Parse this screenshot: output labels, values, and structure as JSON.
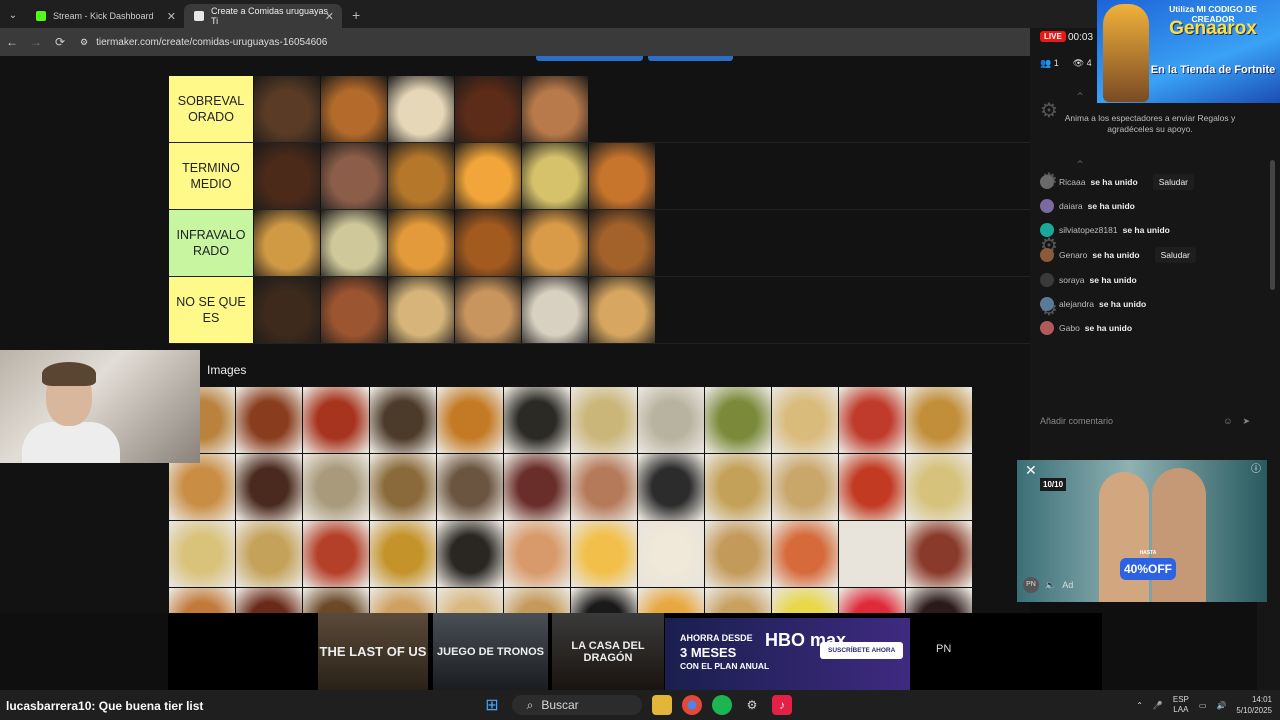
{
  "browser": {
    "tabs": [
      {
        "label": "Stream - Kick Dashboard",
        "favicon_color": "#53fc18"
      },
      {
        "label": "Create a Comidas uruguayas Ti",
        "favicon_color": "#e8e8e8"
      }
    ],
    "url": "tiermaker.com/create/comidas-uruguayas-16054606"
  },
  "tiermaker": {
    "tiers": [
      {
        "label": "SOBREVAL ORADO",
        "color": "#fff98a",
        "images": [
          "#5a3b25",
          "#b46a2b",
          "#e6d7b8",
          "#5c2c18",
          "#b87a4a"
        ]
      },
      {
        "label": "TERMINO MEDIO",
        "color": "#fff98a",
        "images": [
          "#4b2a1a",
          "#8c5e4a",
          "#b5782b",
          "#f2a53a",
          "#d6c26a",
          "#c7742d"
        ]
      },
      {
        "label": "INFRAVALO RADO",
        "color": "#c8f5a0",
        "images": [
          "#d09a45",
          "#cfc89a",
          "#e39a3a",
          "#a25a1f",
          "#d99b48",
          "#a2622a"
        ]
      },
      {
        "label": "NO SE QUE ES",
        "color": "#fff98a",
        "images": [
          "#3d2a1c",
          "#9b5530",
          "#d7b57a",
          "#c9955e",
          "#d8d0c0",
          "#d7a761"
        ]
      }
    ],
    "images_title": "Images",
    "pool_colors": [
      "#b9823d",
      "#8a3d1e",
      "#a7341f",
      "#4c3a2a",
      "#c47a25",
      "#2b2a24",
      "#cbb67a",
      "#b8b3a0",
      "#7a8a3a",
      "#d9bb7b",
      "#c03b2b",
      "#c28e3a",
      "#c98e44",
      "#4a2a1e",
      "#a89a7a",
      "#8a6a3a",
      "#6b5540",
      "#6a2e2a",
      "#b57a5a",
      "#2c2c2c",
      "#c4a158",
      "#c9a66a",
      "#c23a22",
      "#d6c27a",
      "#d9c27a",
      "#c4a25a",
      "#b5402a",
      "#c4942a",
      "#2a2622",
      "#d89a6a",
      "#f2c04a",
      "#f0e8d8",
      "#c49a5a",
      "#d66a3a",
      "#e8e4dc",
      "#8a3a2a",
      "#c27a3a",
      "#6a2a1a",
      "#6b4a2a",
      "#cfa060",
      "#d9b880",
      "#c49a5a",
      "#1a1a1a",
      "#e8a840",
      "#c8a060",
      "#e8d84a",
      "#e02a3a",
      "#2a1a1a"
    ]
  },
  "webcam": {
    "label": "streamer webcam"
  },
  "chat": {
    "live_badge": "LIVE",
    "timer": "00:03",
    "viewers_count": "1",
    "eye_count": "4",
    "hint": "Anima a los espectadores a enviar Regalos y agradéceles su apoyo.",
    "messages": [
      {
        "user": "Ricaaa",
        "text": "se ha unido",
        "action": "Saludar",
        "avatar": "#6a6a6a"
      },
      {
        "user": "daiara",
        "text": "se ha unido",
        "action": "",
        "avatar": "#7a6aa0"
      },
      {
        "user": "silviatopez8181",
        "text": "se ha unido",
        "action": "",
        "avatar": "#1aa89a"
      },
      {
        "user": "Genaro",
        "text": "se ha unido",
        "action": "Saludar",
        "avatar": "#8a5a3a"
      },
      {
        "user": "soraya",
        "text": "se ha unido",
        "action": "",
        "avatar": "#3a3a3a"
      },
      {
        "user": "alejandra",
        "text": "se ha unido",
        "action": "",
        "avatar": "#5a7a9a"
      },
      {
        "user": "Gabo",
        "text": "se ha unido",
        "action": "",
        "avatar": "#b05a5a"
      }
    ],
    "input_placeholder": "Añadir comentario"
  },
  "fortnite_banner": {
    "line1": "Utiliza MI CODIGO DE CREADOR",
    "code": "Genaarox",
    "line3": "En la Tienda de Fortnite"
  },
  "ad": {
    "rating": "10/10",
    "deal_top": "HASTA",
    "deal": "40%OFF",
    "ad_label": "Ad",
    "pn": "PN"
  },
  "hbo_banner": {
    "poster1": "THE LAST OF US",
    "poster2": "JUEGO DE TRONOS",
    "poster3": "LA CASA DEL DRAGÓN",
    "promo_line1": "AHORRA DESDE",
    "promo_line2": "3 MESES",
    "promo_line3": "CON EL PLAN ANUAL",
    "logo": "HBO max",
    "cta": "SUSCRÍBETE AHORA",
    "pn": "PN"
  },
  "chat_overlay": {
    "user": "lucasbarrera10",
    "text": ": Que buena tier list"
  },
  "taskbar": {
    "search_label": "Buscar",
    "lang_top": "ESP",
    "lang_bottom": "LAA",
    "time": "14:01",
    "date": "5/10/2025"
  }
}
